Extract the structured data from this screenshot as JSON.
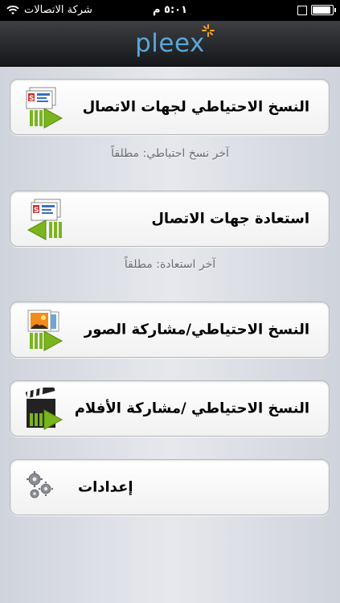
{
  "status_bar": {
    "carrier": "شركة الاتصالات",
    "time": "٥:٠١ م",
    "wifi_icon": "wifi-icon",
    "battery_icon": "battery-icon"
  },
  "nav": {
    "logo_text": "pleex",
    "logo_color": "#5aa7d8",
    "spark_color": "#f2a31d"
  },
  "menu": {
    "backup_contacts": {
      "label": "النسخ الاحتياطي لجهات الاتصال",
      "icon": "contacts-backup-icon"
    },
    "backup_caption": "آخر نسخ احتياطي: مطلقاً",
    "restore_contacts": {
      "label": "استعادة جهات الاتصال",
      "icon": "contacts-restore-icon"
    },
    "restore_caption": "آخر استعادة: مطلقاً",
    "photos": {
      "label": "النسخ الاحتياطي/مشاركة الصور",
      "icon": "photos-share-icon"
    },
    "videos": {
      "label": "النسخ الاحتياطي /مشاركة الأفلام",
      "icon": "movies-share-icon"
    },
    "settings": {
      "label": "إعدادات",
      "icon": "gears-icon"
    }
  },
  "colors": {
    "arrow_green": "#7ab51d",
    "caption_gray": "#6b6e73"
  }
}
